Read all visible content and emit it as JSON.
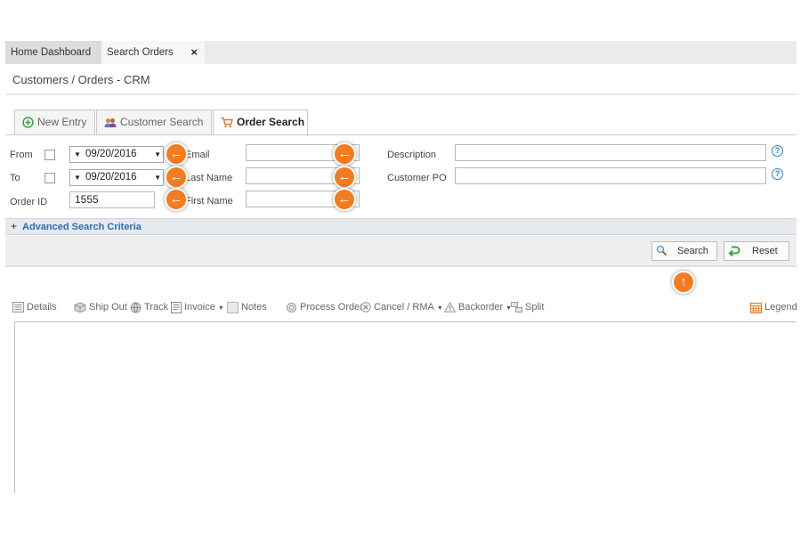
{
  "tabs": {
    "home": "Home Dashboard",
    "active": "Search Orders",
    "close": "×"
  },
  "breadcrumb": "Customers / Orders - CRM",
  "subtabs": {
    "new_entry": "New Entry",
    "customer_search": "Customer Search",
    "order_search": "Order Search"
  },
  "form": {
    "from_label": "From",
    "to_label": "To",
    "order_id_label": "Order ID",
    "from_date": "09/20/2016",
    "to_date": "09/20/2016",
    "order_id_value": "1555",
    "email_label": "Email",
    "last_name_label": "Last Name",
    "first_name_label": "First Name",
    "description_label": "Description",
    "customer_po_label": "Customer PO",
    "help_glyph": "?"
  },
  "advanced": {
    "plus": "+",
    "label": "Advanced Search Criteria"
  },
  "buttons": {
    "search": "Search",
    "reset": "Reset"
  },
  "toolbar": {
    "details": "Details",
    "ship_out": "Ship Out",
    "track": "Track",
    "invoice": "Invoice",
    "notes": "Notes",
    "process_order": "Process Order",
    "cancel_rma": "Cancel / RMA",
    "backorder": "Backorder",
    "split": "Split",
    "legend": "Legend"
  },
  "markers": {
    "left_arrow": "←",
    "up_arrow": "↑"
  },
  "colors": {
    "accent_orange": "#f47b20",
    "link_blue": "#2a6fb8"
  }
}
